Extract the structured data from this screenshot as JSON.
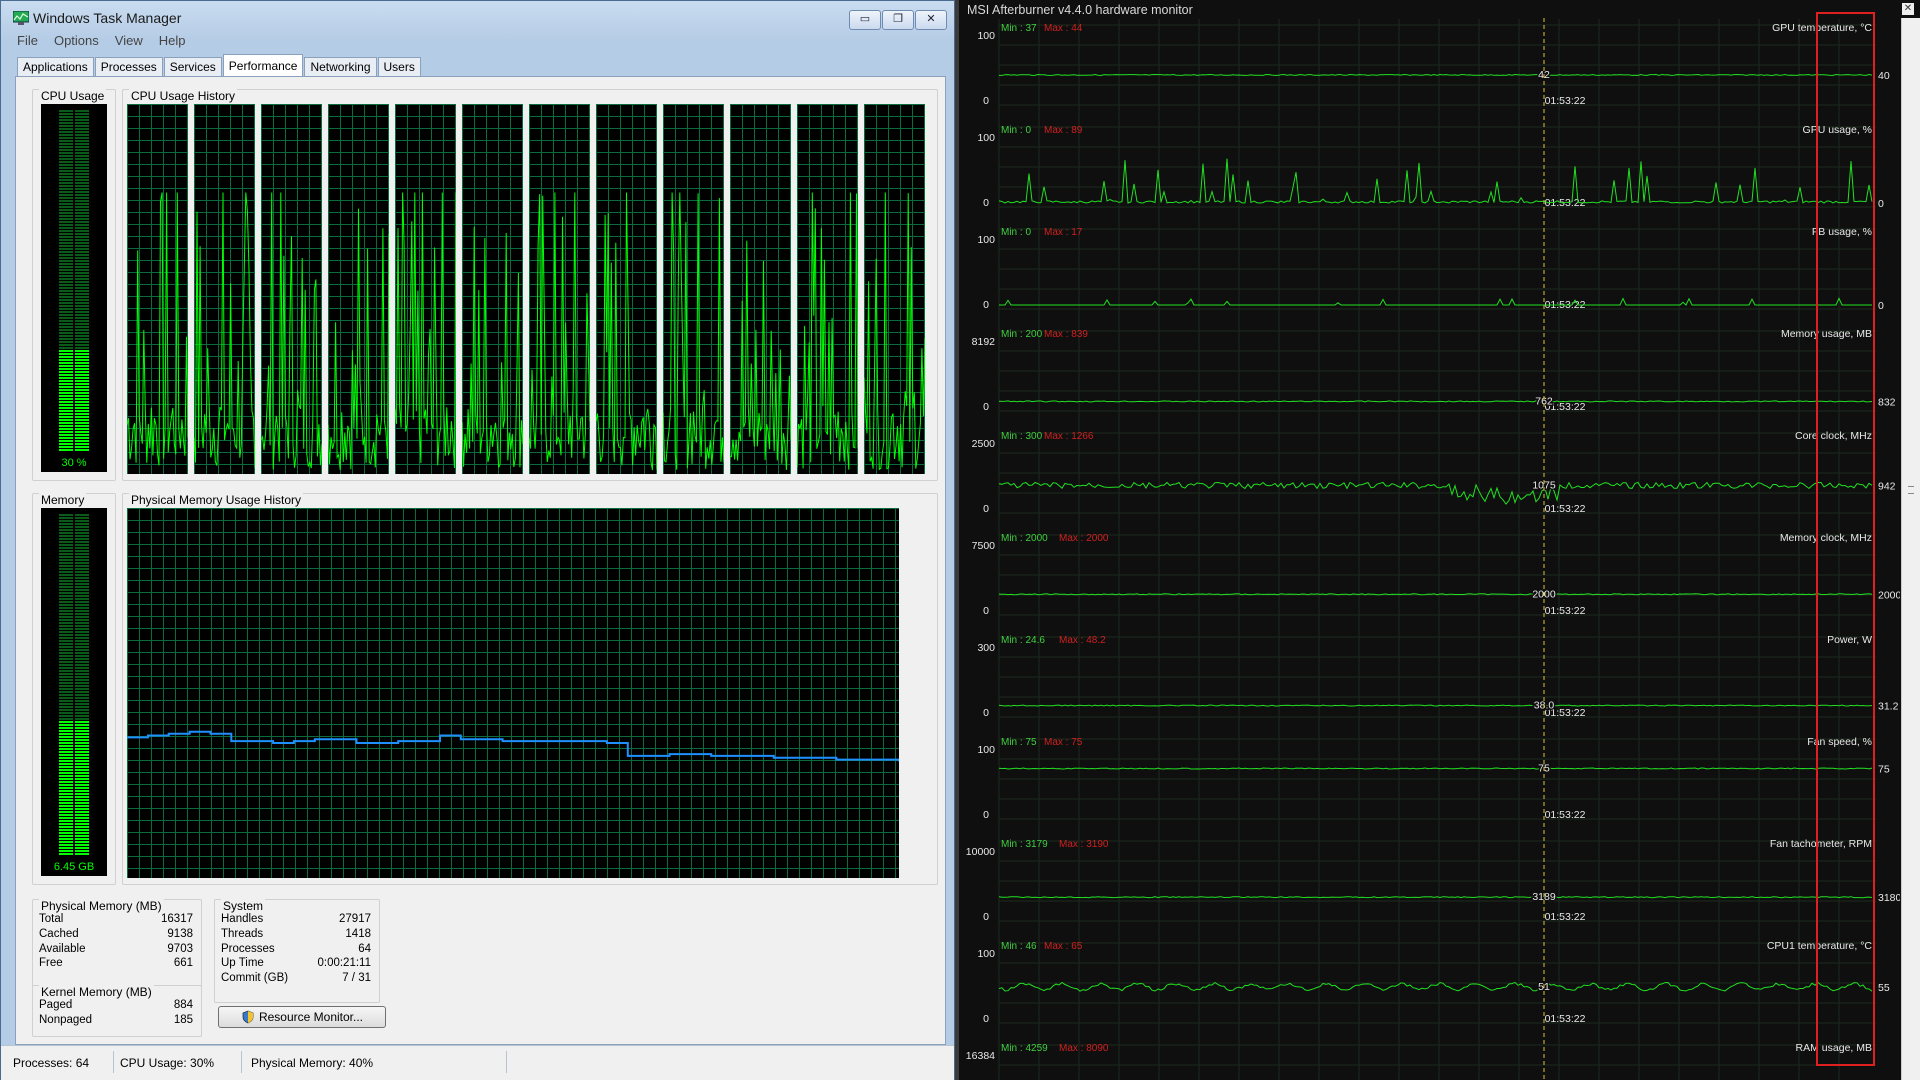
{
  "task_manager": {
    "title": "Windows Task Manager",
    "window_buttons": {
      "minimize": "▭",
      "restore": "❐",
      "close": "✕"
    },
    "menu": [
      "File",
      "Options",
      "View",
      "Help"
    ],
    "tabs": [
      "Applications",
      "Processes",
      "Services",
      "Performance",
      "Networking",
      "Users"
    ],
    "active_tab": "Performance",
    "cpu_usage_label": "CPU Usage",
    "cpu_usage_value": "30 %",
    "cpu_usage_fraction": 0.3,
    "cpu_history_label": "CPU Usage History",
    "cpu_core_count": 12,
    "memory_label": "Memory",
    "memory_value": "6.45 GB",
    "memory_fraction": 0.4,
    "memory_history_label": "Physical Memory Usage History",
    "memory_history": [
      0.38,
      0.385,
      0.39,
      0.395,
      0.39,
      0.37,
      0.37,
      0.365,
      0.37,
      0.375,
      0.375,
      0.365,
      0.365,
      0.37,
      0.37,
      0.385,
      0.375,
      0.375,
      0.37,
      0.37,
      0.37,
      0.37,
      0.37,
      0.365,
      0.33,
      0.33,
      0.335,
      0.335,
      0.33,
      0.33,
      0.33,
      0.325,
      0.325,
      0.325,
      0.32,
      0.32,
      0.32,
      0.315
    ],
    "physical_memory": {
      "title": "Physical Memory (MB)",
      "rows": [
        {
          "label": "Total",
          "value": "16317"
        },
        {
          "label": "Cached",
          "value": "9138"
        },
        {
          "label": "Available",
          "value": "9703"
        },
        {
          "label": "Free",
          "value": "661"
        }
      ]
    },
    "kernel_memory": {
      "title": "Kernel Memory (MB)",
      "rows": [
        {
          "label": "Paged",
          "value": "884"
        },
        {
          "label": "Nonpaged",
          "value": "185"
        }
      ]
    },
    "system": {
      "title": "System",
      "rows": [
        {
          "label": "Handles",
          "value": "27917"
        },
        {
          "label": "Threads",
          "value": "1418"
        },
        {
          "label": "Processes",
          "value": "64"
        },
        {
          "label": "Up Time",
          "value": "0:00:21:11"
        },
        {
          "label": "Commit (GB)",
          "value": "7 / 31"
        }
      ]
    },
    "resource_monitor_button": "Resource Monitor...",
    "status": {
      "processes": "Processes: 64",
      "cpu": "CPU Usage: 30%",
      "memory": "Physical Memory: 40%"
    },
    "colors": {
      "graph_green": "#00ff00",
      "memory_line": "#1e90ff",
      "grid": "#0a6b3c"
    }
  },
  "afterburner": {
    "title": "MSI Afterburner v4.4.0 hardware monitor",
    "close_label": "✕",
    "highlight_color": "#e02020",
    "panels": [
      {
        "label": "GPU temperature, °C",
        "min": "Min : 37",
        "max": "Max : 44",
        "ytop": "100",
        "ybot": "0",
        "cursor_value": "42",
        "cursor_time": "01:53:22",
        "current": "40",
        "level": 0.42,
        "style": "flat"
      },
      {
        "label": "GPU usage, %",
        "min": "Min : 0",
        "max": "Max : 89",
        "ytop": "100",
        "ybot": "0",
        "cursor_value": "",
        "cursor_time": "01:53:22",
        "current": "0",
        "level": 0.0,
        "style": "spiky"
      },
      {
        "label": "FB usage, %",
        "min": "Min : 0",
        "max": "Max : 17",
        "ytop": "100",
        "ybot": "0",
        "cursor_value": "",
        "cursor_time": "01:53:22",
        "current": "0",
        "level": 0.0,
        "style": "lowspike"
      },
      {
        "label": "Memory usage, MB",
        "min": "Min : 200",
        "max": "Max : 839",
        "ytop": "8192",
        "ybot": "0",
        "cursor_value": "762",
        "cursor_time": "01:53:22",
        "current": "832",
        "level": 0.09,
        "style": "flat"
      },
      {
        "label": "Core clock, MHz",
        "min": "Min : 300",
        "max": "Max : 1266",
        "ytop": "2500",
        "ybot": "0",
        "cursor_value": "1075",
        "cursor_time": "01:53:22",
        "current": "942",
        "level": 0.38,
        "style": "noisy"
      },
      {
        "label": "Memory clock, MHz",
        "min": "Min : 2000",
        "max": "Max : 2000",
        "ytop": "7500",
        "ybot": "0",
        "cursor_value": "2000",
        "cursor_time": "01:53:22",
        "current": "2000",
        "level": 0.27,
        "style": "flat"
      },
      {
        "label": "Power, W",
        "min": "Min : 24.6",
        "max": "Max : 48.2",
        "ytop": "300",
        "ybot": "0",
        "cursor_value": "38.0",
        "cursor_time": "01:53:22",
        "current": "31.2",
        "level": 0.12,
        "style": "flat"
      },
      {
        "label": "Fan speed, %",
        "min": "Min : 75",
        "max": "Max : 75",
        "ytop": "100",
        "ybot": "0",
        "cursor_value": "75",
        "cursor_time": "01:53:22",
        "current": "75",
        "level": 0.75,
        "style": "flat"
      },
      {
        "label": "Fan tachometer, RPM",
        "min": "Min : 3179",
        "max": "Max : 3190",
        "ytop": "10000",
        "ybot": "0",
        "cursor_value": "3189",
        "cursor_time": "01:53:22",
        "current": "3180",
        "level": 0.32,
        "style": "flat"
      },
      {
        "label": "CPU1 temperature, °C",
        "min": "Min : 46",
        "max": "Max : 65",
        "ytop": "100",
        "ybot": "0",
        "cursor_value": "51",
        "cursor_time": "01:53:22",
        "current": "55",
        "level": 0.52,
        "style": "wavy"
      },
      {
        "label": "RAM usage, MB",
        "min": "Min : 4259",
        "max": "Max : 8090",
        "ytop": "16384",
        "ybot": "",
        "cursor_value": "",
        "cursor_time": "",
        "current": "",
        "level": 0.3,
        "style": "none"
      }
    ]
  }
}
